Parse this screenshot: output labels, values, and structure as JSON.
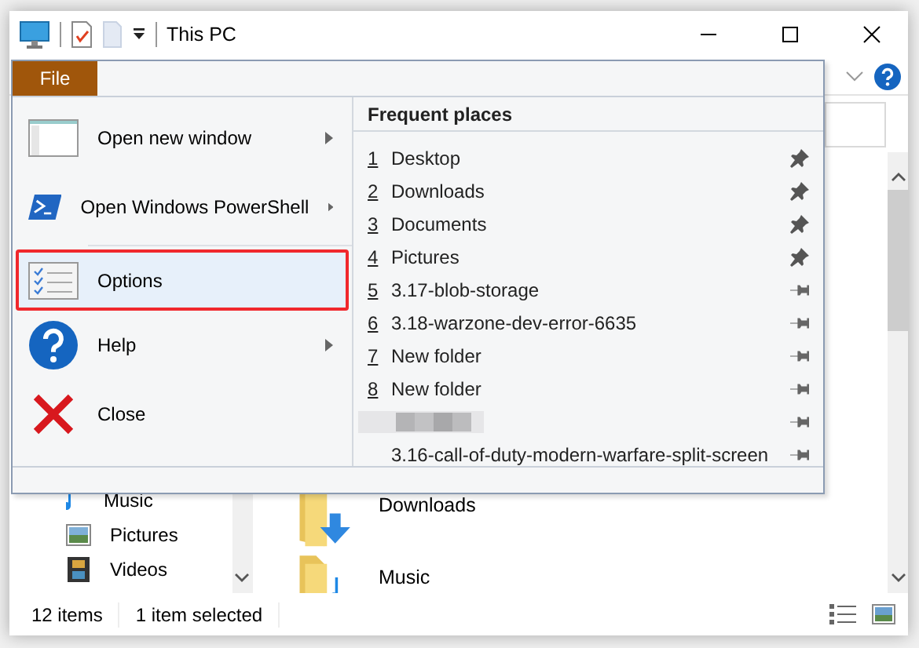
{
  "window": {
    "title": "This PC"
  },
  "file_menu": {
    "tab": "File",
    "items": [
      {
        "label": "Open new window",
        "kind": "window",
        "submenu": true,
        "selected": false
      },
      {
        "label": "Open Windows PowerShell",
        "kind": "powershell",
        "submenu": true,
        "selected": false
      },
      {
        "label": "Options",
        "kind": "options",
        "submenu": false,
        "selected": true
      },
      {
        "label": "Help",
        "kind": "help",
        "submenu": true,
        "selected": false
      },
      {
        "label": "Close",
        "kind": "close",
        "submenu": false,
        "selected": false
      }
    ],
    "frequent_places": {
      "title": "Frequent places",
      "items": [
        {
          "kind": "place",
          "number": "1",
          "name": "Desktop",
          "pinned": true
        },
        {
          "kind": "place",
          "number": "2",
          "name": "Downloads",
          "pinned": true
        },
        {
          "kind": "place",
          "number": "3",
          "name": "Documents",
          "pinned": true
        },
        {
          "kind": "place",
          "number": "4",
          "name": "Pictures",
          "pinned": true
        },
        {
          "kind": "place",
          "number": "5",
          "name": "3.17-blob-storage",
          "pinned": false
        },
        {
          "kind": "place",
          "number": "6",
          "name": "3.18-warzone-dev-error-6635",
          "pinned": false
        },
        {
          "kind": "place",
          "number": "7",
          "name": "New folder",
          "pinned": false
        },
        {
          "kind": "place",
          "number": "8",
          "name": "New folder",
          "pinned": false
        },
        {
          "kind": "blurred",
          "pinned": false
        },
        {
          "kind": "place",
          "name": "3.16-call-of-duty-modern-warfare-split-screen",
          "pinned": false
        }
      ]
    }
  },
  "navigation_pane": {
    "items": [
      {
        "label": "Music",
        "kind": "music"
      },
      {
        "label": "Pictures",
        "kind": "pictures"
      },
      {
        "label": "Videos",
        "kind": "videos"
      }
    ]
  },
  "content": {
    "items": [
      {
        "label": "Downloads",
        "kind": "downloads"
      },
      {
        "label": "Music",
        "kind": "music"
      }
    ]
  },
  "status_bar": {
    "item_count": "12 items",
    "selection": "1 item selected"
  }
}
